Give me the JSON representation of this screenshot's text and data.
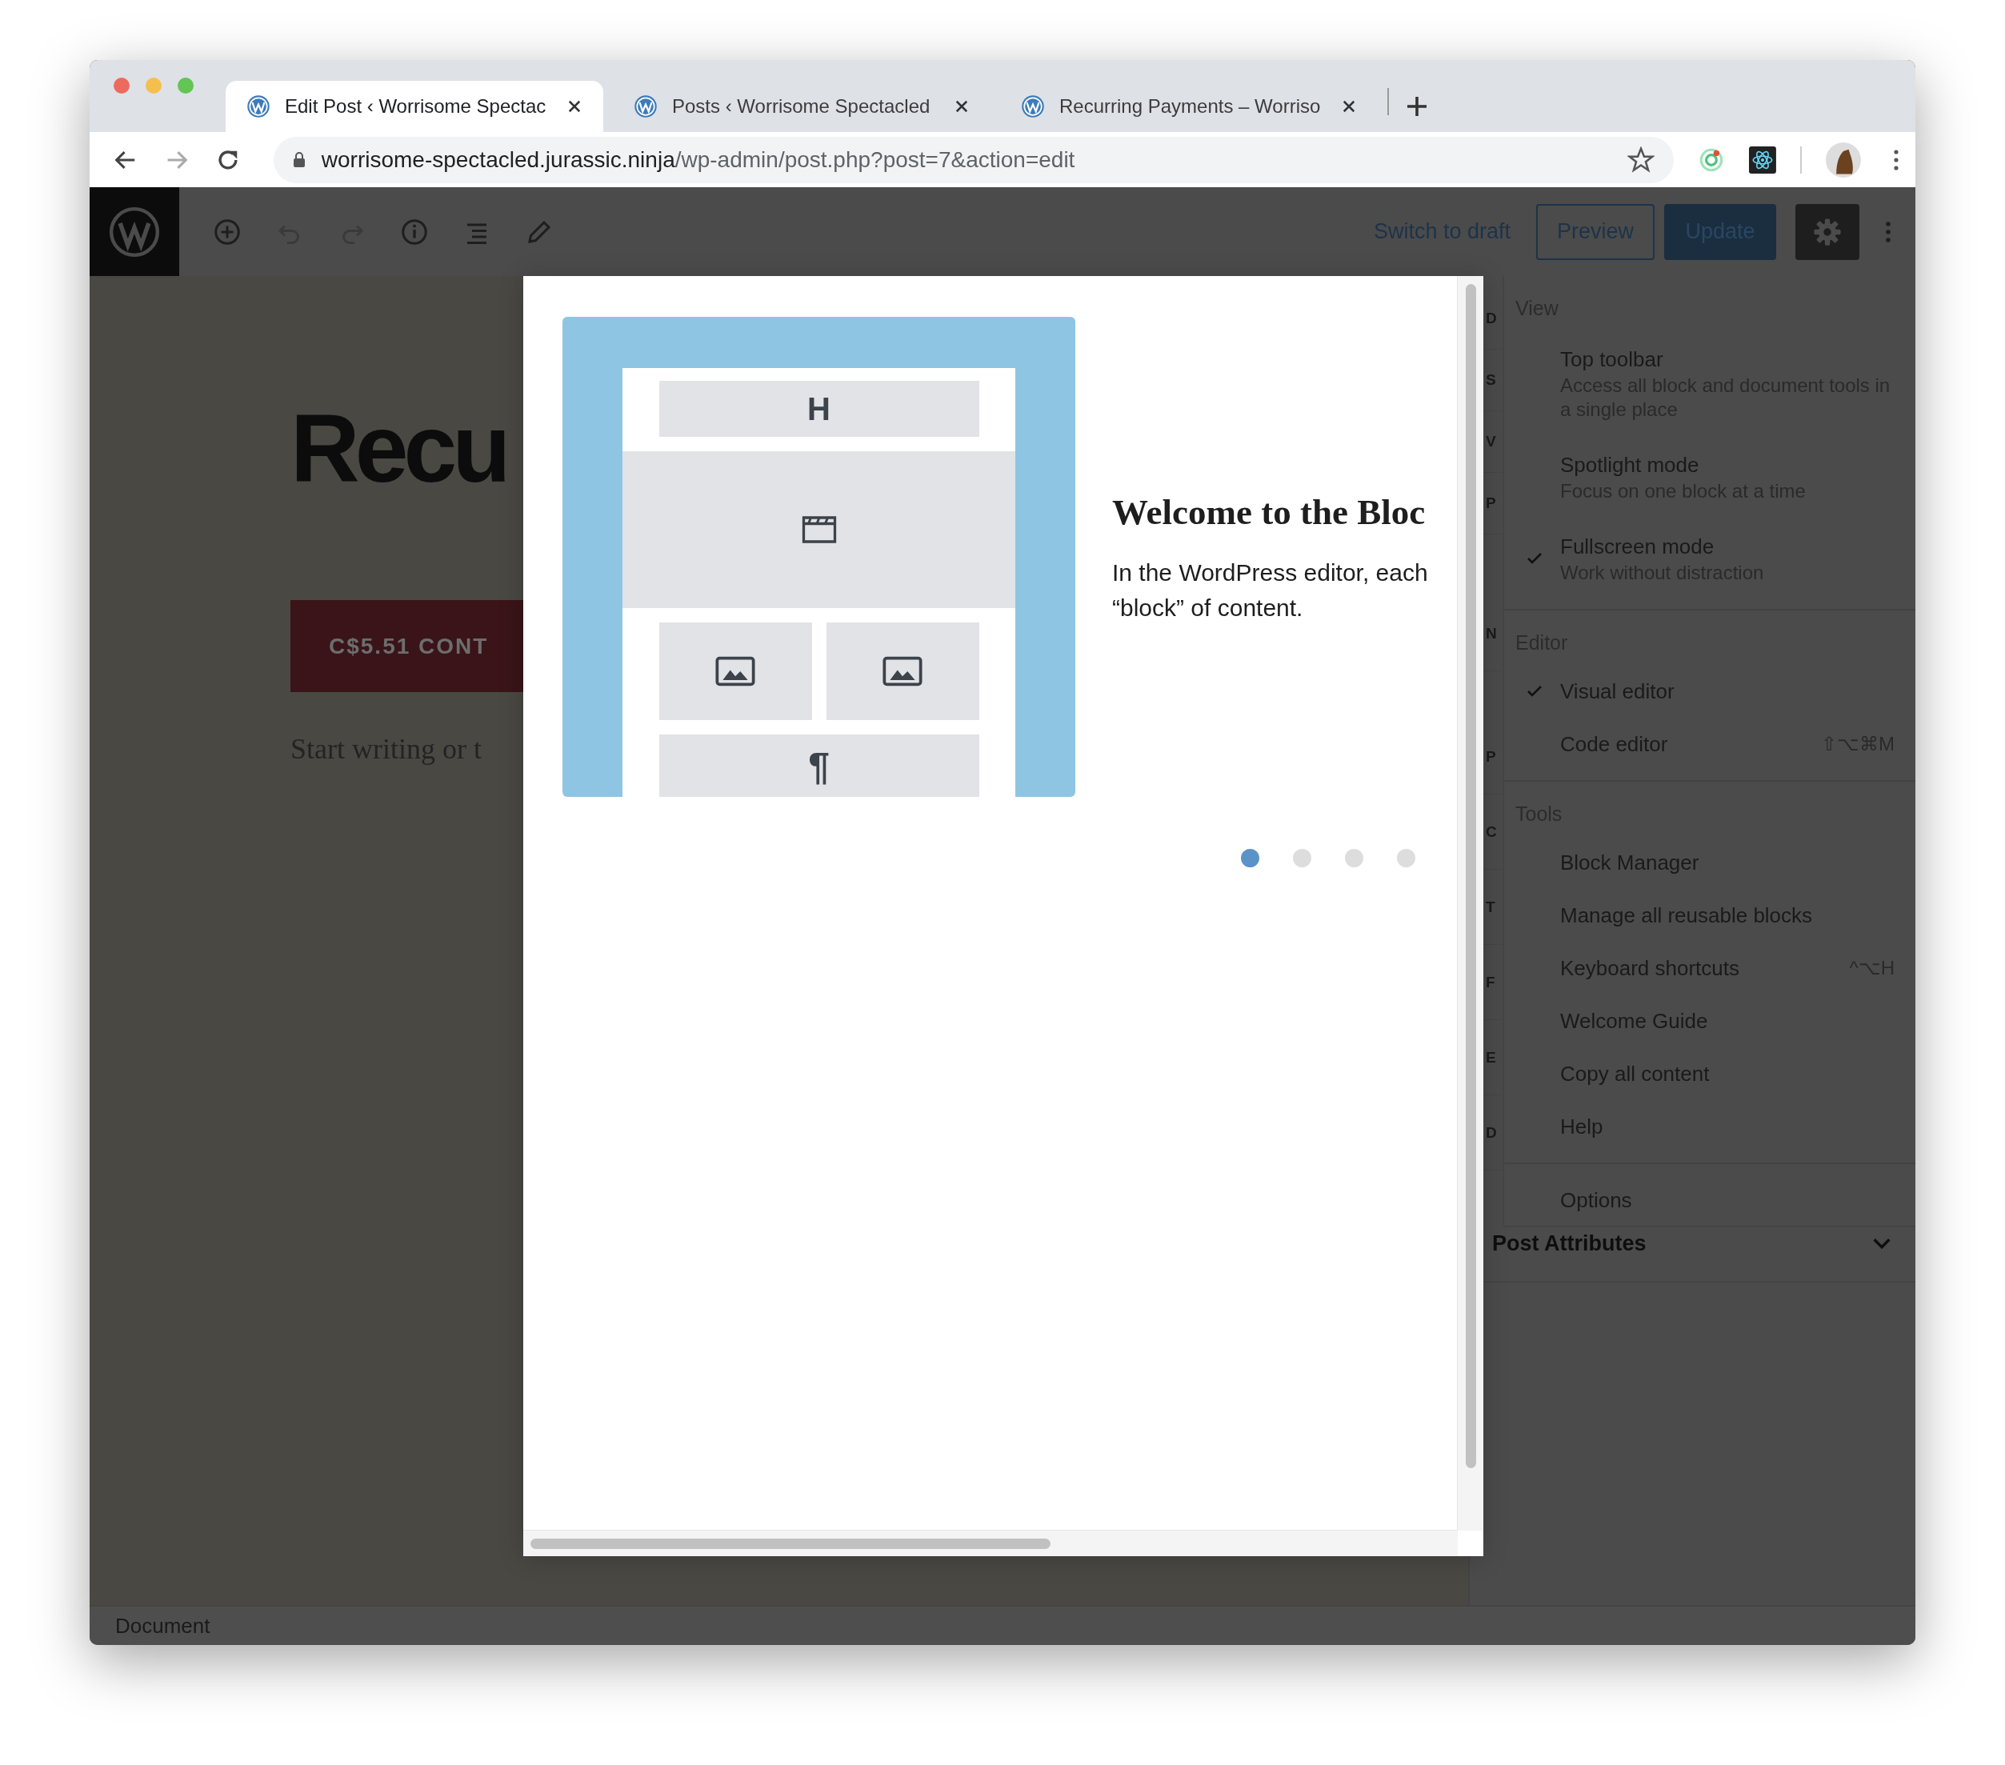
{
  "browser": {
    "tabs": [
      {
        "title": "Edit Post ‹ Worrisome Spectac",
        "selected": true
      },
      {
        "title": "Posts ‹ Worrisome Spectacled",
        "selected": false
      },
      {
        "title": "Recurring Payments – Worriso",
        "selected": false
      }
    ],
    "address": {
      "host": "worrisome-spectacled.jurassic.ninja",
      "path": "/wp-admin/post.php?post=7&action=edit"
    }
  },
  "toolbar": {
    "switch_to_draft": "Switch to draft",
    "preview": "Preview",
    "update": "Update"
  },
  "editor": {
    "title": "Recu",
    "button": "C$5.51 CONT",
    "placeholder": "Start writing or t"
  },
  "sidebar": {
    "fragments": [
      "D",
      "S",
      "V",
      "P",
      "N",
      "P",
      "C",
      "T",
      "F",
      "E",
      "D"
    ],
    "post_attributes": "Post Attributes"
  },
  "more_menu": {
    "groups": [
      {
        "label": "View",
        "items": [
          {
            "label": "Top toolbar",
            "description": "Access all block and document tools in a single place",
            "checked": false
          },
          {
            "label": "Spotlight mode",
            "description": "Focus on one block at a time",
            "checked": false
          },
          {
            "label": "Fullscreen mode",
            "description": "Work without distraction",
            "checked": true
          }
        ]
      },
      {
        "label": "Editor",
        "items": [
          {
            "label": "Visual editor",
            "checked": true
          },
          {
            "label": "Code editor",
            "shortcut": "⇧⌥⌘M",
            "checked": false
          }
        ]
      },
      {
        "label": "Tools",
        "items": [
          {
            "label": "Block Manager"
          },
          {
            "label": "Manage all reusable blocks"
          },
          {
            "label": "Keyboard shortcuts",
            "shortcut": "^⌥H"
          },
          {
            "label": "Welcome Guide"
          },
          {
            "label": "Copy all content"
          },
          {
            "label": "Help"
          }
        ]
      },
      {
        "items": [
          {
            "label": "Options"
          }
        ]
      }
    ]
  },
  "welcome_guide": {
    "illustration": {
      "heading_glyph": "H",
      "paragraph_glyph": "¶"
    },
    "title": "Welcome to the Bloc",
    "lines": [
      "In the WordPress editor, each",
      "“block” of content."
    ],
    "pages": [
      {
        "selected": true
      },
      {
        "selected": false
      },
      {
        "selected": false
      },
      {
        "selected": false
      }
    ]
  },
  "status_bar": {
    "label": "Document"
  }
}
